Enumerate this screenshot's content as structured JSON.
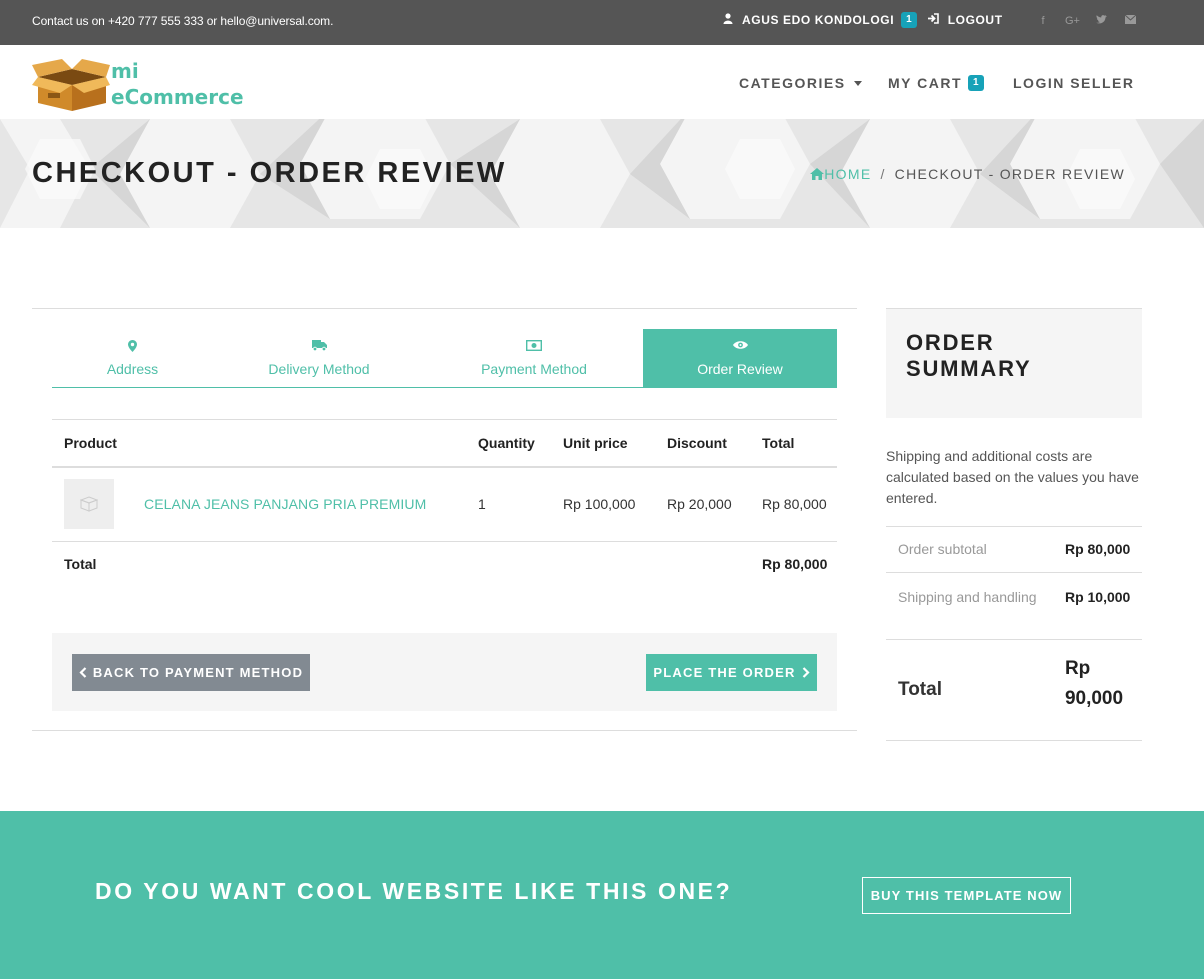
{
  "topbar": {
    "contact": "Contact us on +420 777 555 333 or hello@universal.com.",
    "user_name": "AGUS EDO KONDOLOGI",
    "user_badge": "1",
    "logout": "LOGOUT",
    "social_icons": [
      "facebook-icon",
      "google-plus-icon",
      "twitter-icon",
      "envelope-icon"
    ]
  },
  "nav": {
    "logo_line1": "mi",
    "logo_line2": "eCommerce",
    "categories": "CATEGORIES",
    "my_cart": "MY CART",
    "cart_badge": "1",
    "login_seller": "LOGIN SELLER"
  },
  "hero": {
    "title": "CHECKOUT - ORDER REVIEW",
    "breadcrumb_home": "HOME",
    "breadcrumb_sep": "/",
    "breadcrumb_current": "CHECKOUT - ORDER REVIEW"
  },
  "steps": [
    {
      "label": "Address",
      "icon": "map-marker-icon"
    },
    {
      "label": "Delivery Method",
      "icon": "truck-icon"
    },
    {
      "label": "Payment Method",
      "icon": "money-icon"
    },
    {
      "label": "Order Review",
      "icon": "eye-icon",
      "active": true
    }
  ],
  "cart": {
    "headers": [
      "Product",
      "Quantity",
      "Unit price",
      "Discount",
      "Total"
    ],
    "rows": [
      {
        "product": "CELANA JEANS PANJANG PRIA PREMIUM",
        "quantity": "1",
        "unit_price": "Rp 100,000",
        "discount": "Rp 20,000",
        "total": "Rp 80,000"
      }
    ],
    "total_label": "Total",
    "total_value": "Rp 80,000"
  },
  "actions": {
    "back": "BACK TO PAYMENT METHOD",
    "place": "PLACE THE ORDER"
  },
  "summary": {
    "title": "ORDER SUMMARY",
    "note": "Shipping and additional costs are calculated based on the values you have entered.",
    "subtotal_label": "Order subtotal",
    "subtotal_value": "Rp 80,000",
    "shipping_label": "Shipping and handling",
    "shipping_value": "Rp 10,000",
    "total_label": "Total",
    "total_value": "Rp 90,000"
  },
  "cta": {
    "heading": "DO YOU WANT COOL WEBSITE LIKE THIS ONE?",
    "button": "BUY THIS TEMPLATE NOW"
  },
  "colors": {
    "accent": "#4fbfa8",
    "topbar": "#555555",
    "badge": "#17a2b8",
    "back_button": "#828a92"
  }
}
